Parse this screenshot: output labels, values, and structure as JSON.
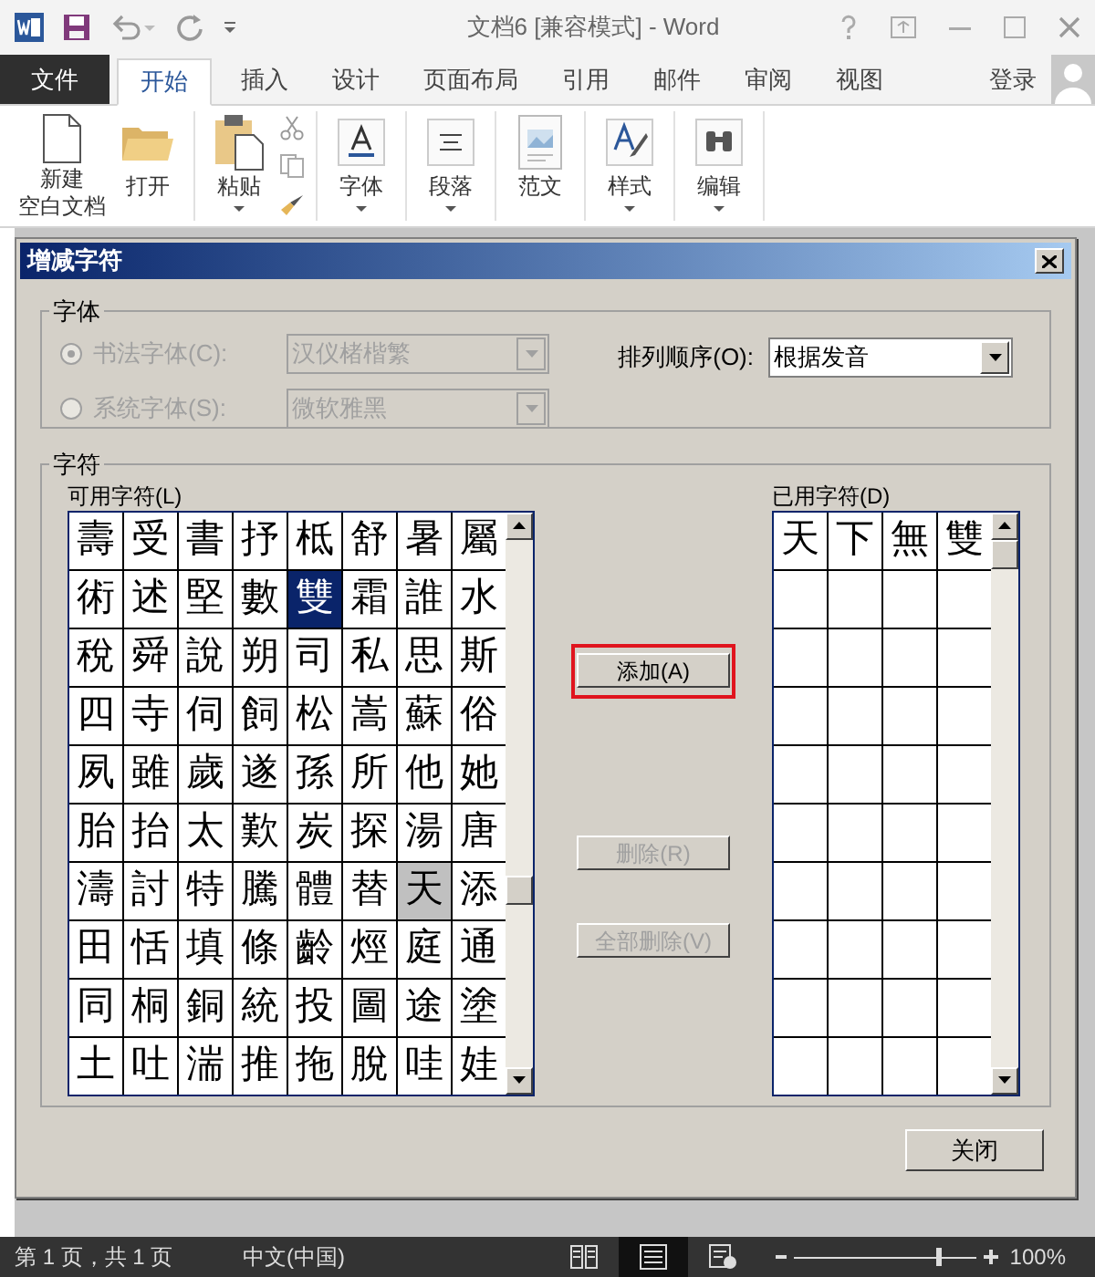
{
  "window": {
    "title": "文档6 [兼容模式] - Word"
  },
  "tabs": [
    {
      "label": "文件",
      "kind": "file",
      "selected": false
    },
    {
      "label": "开始",
      "kind": "tab",
      "selected": true
    },
    {
      "label": "插入",
      "kind": "tab",
      "selected": false
    },
    {
      "label": "设计",
      "kind": "tab",
      "selected": false
    },
    {
      "label": "页面布局",
      "kind": "tab",
      "selected": false
    },
    {
      "label": "引用",
      "kind": "tab",
      "selected": false
    },
    {
      "label": "邮件",
      "kind": "tab",
      "selected": false
    },
    {
      "label": "审阅",
      "kind": "tab",
      "selected": false
    },
    {
      "label": "视图",
      "kind": "tab",
      "selected": false
    }
  ],
  "account": {
    "label": "登录"
  },
  "ribbon": {
    "groups": [
      {
        "items": [
          {
            "label_lines": [
              "新建",
              "空白文档"
            ],
            "kind": "page",
            "dropdown": false
          },
          {
            "label_lines": [
              "打开"
            ],
            "kind": "folder",
            "dropdown": false
          }
        ]
      },
      {
        "items": [
          {
            "label_lines": [
              "粘贴"
            ],
            "kind": "clipboard",
            "dropdown": true
          }
        ]
      },
      {
        "items": [
          {
            "label_lines": [
              "字体"
            ],
            "kind": "font",
            "dropdown": true
          }
        ]
      },
      {
        "items": [
          {
            "label_lines": [
              "段落"
            ],
            "kind": "paragraph",
            "dropdown": true
          }
        ]
      },
      {
        "items": [
          {
            "label_lines": [
              "范文"
            ],
            "kind": "template",
            "dropdown": false
          }
        ]
      },
      {
        "items": [
          {
            "label_lines": [
              "样式"
            ],
            "kind": "styles",
            "dropdown": true
          }
        ]
      },
      {
        "items": [
          {
            "label_lines": [
              "编辑"
            ],
            "kind": "binoculars",
            "dropdown": true
          }
        ]
      }
    ]
  },
  "dialog": {
    "title": "增减字符",
    "font_group": {
      "label": "字体",
      "disabled": true,
      "options": [
        {
          "label": "书法字体(C):",
          "selected": true,
          "value": "汉仪楮楷繁"
        },
        {
          "label": "系统字体(S):",
          "selected": false,
          "value": "微软雅黑"
        }
      ],
      "sort_label": "排列顺序(O):",
      "sort_value": "根据发音"
    },
    "chars_group": {
      "label": "字符",
      "available_label": "可用字符(L)",
      "used_label": "已用字符(D)",
      "available": [
        [
          {
            "char": "壽",
            "selected": false,
            "used": false
          },
          {
            "char": "受",
            "selected": false,
            "used": false
          },
          {
            "char": "書",
            "selected": false,
            "used": false
          },
          {
            "char": "抒",
            "selected": false,
            "used": false
          },
          {
            "char": "柢",
            "selected": false,
            "used": false
          },
          {
            "char": "舒",
            "selected": false,
            "used": false
          },
          {
            "char": "暑",
            "selected": false,
            "used": false
          },
          {
            "char": "屬",
            "selected": false,
            "used": false
          }
        ],
        [
          {
            "char": "術",
            "selected": false,
            "used": false
          },
          {
            "char": "述",
            "selected": false,
            "used": false
          },
          {
            "char": "堅",
            "selected": false,
            "used": false
          },
          {
            "char": "數",
            "selected": false,
            "used": false
          },
          {
            "char": "雙",
            "selected": true,
            "used": false
          },
          {
            "char": "霜",
            "selected": false,
            "used": false
          },
          {
            "char": "誰",
            "selected": false,
            "used": false
          },
          {
            "char": "水",
            "selected": false,
            "used": false
          }
        ],
        [
          {
            "char": "稅",
            "selected": false,
            "used": false
          },
          {
            "char": "舜",
            "selected": false,
            "used": false
          },
          {
            "char": "說",
            "selected": false,
            "used": false
          },
          {
            "char": "朔",
            "selected": false,
            "used": false
          },
          {
            "char": "司",
            "selected": false,
            "used": false
          },
          {
            "char": "私",
            "selected": false,
            "used": false
          },
          {
            "char": "思",
            "selected": false,
            "used": false
          },
          {
            "char": "斯",
            "selected": false,
            "used": false
          }
        ],
        [
          {
            "char": "四",
            "selected": false,
            "used": false
          },
          {
            "char": "寺",
            "selected": false,
            "used": false
          },
          {
            "char": "伺",
            "selected": false,
            "used": false
          },
          {
            "char": "飼",
            "selected": false,
            "used": false
          },
          {
            "char": "松",
            "selected": false,
            "used": false
          },
          {
            "char": "嵩",
            "selected": false,
            "used": false
          },
          {
            "char": "蘇",
            "selected": false,
            "used": false
          },
          {
            "char": "俗",
            "selected": false,
            "used": false
          }
        ],
        [
          {
            "char": "夙",
            "selected": false,
            "used": false
          },
          {
            "char": "雖",
            "selected": false,
            "used": false
          },
          {
            "char": "歲",
            "selected": false,
            "used": false
          },
          {
            "char": "遂",
            "selected": false,
            "used": false
          },
          {
            "char": "孫",
            "selected": false,
            "used": false
          },
          {
            "char": "所",
            "selected": false,
            "used": false
          },
          {
            "char": "他",
            "selected": false,
            "used": false
          },
          {
            "char": "她",
            "selected": false,
            "used": false
          }
        ],
        [
          {
            "char": "胎",
            "selected": false,
            "used": false
          },
          {
            "char": "抬",
            "selected": false,
            "used": false
          },
          {
            "char": "太",
            "selected": false,
            "used": false
          },
          {
            "char": "歎",
            "selected": false,
            "used": false
          },
          {
            "char": "炭",
            "selected": false,
            "used": false
          },
          {
            "char": "探",
            "selected": false,
            "used": false
          },
          {
            "char": "湯",
            "selected": false,
            "used": false
          },
          {
            "char": "唐",
            "selected": false,
            "used": false
          }
        ],
        [
          {
            "char": "濤",
            "selected": false,
            "used": false
          },
          {
            "char": "討",
            "selected": false,
            "used": false
          },
          {
            "char": "特",
            "selected": false,
            "used": false
          },
          {
            "char": "騰",
            "selected": false,
            "used": false
          },
          {
            "char": "體",
            "selected": false,
            "used": false
          },
          {
            "char": "替",
            "selected": false,
            "used": false
          },
          {
            "char": "天",
            "selected": false,
            "used": true
          },
          {
            "char": "添",
            "selected": false,
            "used": false
          }
        ],
        [
          {
            "char": "田",
            "selected": false,
            "used": false
          },
          {
            "char": "恬",
            "selected": false,
            "used": false
          },
          {
            "char": "填",
            "selected": false,
            "used": false
          },
          {
            "char": "條",
            "selected": false,
            "used": false
          },
          {
            "char": "齡",
            "selected": false,
            "used": false
          },
          {
            "char": "烴",
            "selected": false,
            "used": false
          },
          {
            "char": "庭",
            "selected": false,
            "used": false
          },
          {
            "char": "通",
            "selected": false,
            "used": false
          }
        ],
        [
          {
            "char": "同",
            "selected": false,
            "used": false
          },
          {
            "char": "桐",
            "selected": false,
            "used": false
          },
          {
            "char": "銅",
            "selected": false,
            "used": false
          },
          {
            "char": "統",
            "selected": false,
            "used": false
          },
          {
            "char": "投",
            "selected": false,
            "used": false
          },
          {
            "char": "圖",
            "selected": false,
            "used": false
          },
          {
            "char": "途",
            "selected": false,
            "used": false
          },
          {
            "char": "塗",
            "selected": false,
            "used": false
          }
        ],
        [
          {
            "char": "土",
            "selected": false,
            "used": false
          },
          {
            "char": "吐",
            "selected": false,
            "used": false
          },
          {
            "char": "湍",
            "selected": false,
            "used": false
          },
          {
            "char": "推",
            "selected": false,
            "used": false
          },
          {
            "char": "拖",
            "selected": false,
            "used": false
          },
          {
            "char": "脫",
            "selected": false,
            "used": false
          },
          {
            "char": "哇",
            "selected": false,
            "used": false
          },
          {
            "char": "娃",
            "selected": false,
            "used": false
          }
        ]
      ],
      "used": [
        "天",
        "下",
        "無",
        "雙"
      ]
    },
    "buttons": [
      {
        "label": "添加(A)",
        "disabled": false,
        "highlighted": true
      },
      {
        "label": "删除(R)",
        "disabled": true,
        "highlighted": false
      },
      {
        "label": "全部删除(V)",
        "disabled": true,
        "highlighted": false
      }
    ],
    "close_button": "关闭"
  },
  "status_bar": {
    "page": "第 1 页，共 1 页",
    "language": "中文(中国)",
    "views": [
      {
        "kind": "read",
        "selected": false
      },
      {
        "kind": "print",
        "selected": true
      },
      {
        "kind": "web",
        "selected": false
      }
    ],
    "zoom_level": {
      "level": 0.8
    },
    "zoom": "100%"
  }
}
